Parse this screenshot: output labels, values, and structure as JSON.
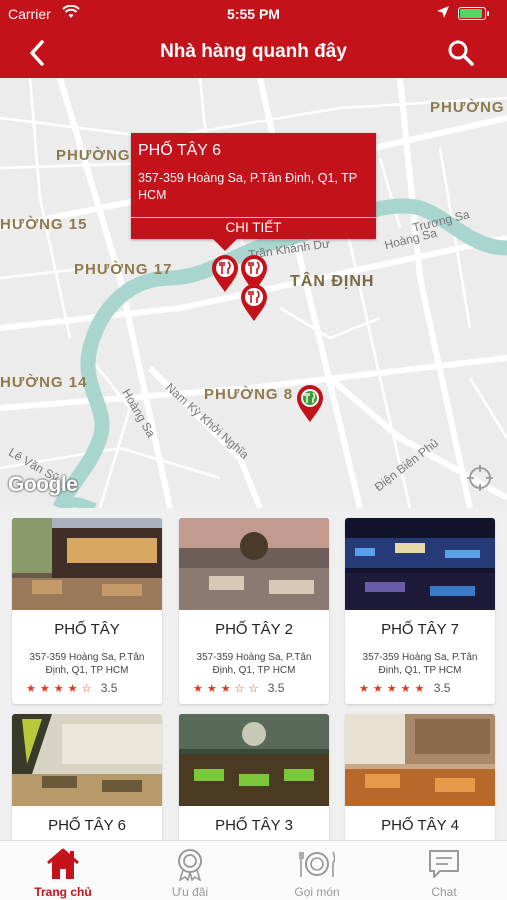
{
  "status_bar": {
    "carrier": "Carrier",
    "time": "5:55 PM",
    "battery_level": 0.9
  },
  "nav": {
    "title": "Nhà hàng quanh đây",
    "back_icon": "chevron-left-icon",
    "search_icon": "search-icon"
  },
  "map": {
    "area_labels": [
      "PHƯỜNG",
      "PHƯỜNG",
      "HƯỜNG 15",
      "PHƯỜNG 17",
      "TÂN ĐỊNH",
      "HƯỜNG 14",
      "PHƯỜNG 8"
    ],
    "street_labels": [
      "Trương Sa",
      "Hoàng Sa",
      "Trần Khánh Dư",
      "Hoàng Sa",
      "Nam Kỳ Khởi Nghĩa",
      "Lê Văn Sỹ",
      "Điện Biên Phủ"
    ],
    "attribution": "Google",
    "callout": {
      "name": "PHỐ TÂY 6",
      "address": "357-359 Hoàng Sa, P.Tân Định, Q1, TP HCM",
      "detail_label": "CHI TIẾT"
    }
  },
  "restaurants": [
    {
      "name": "PHỐ TÂY",
      "address": "357-359 Hoàng Sa, P.Tân Định, Q1, TP HCM",
      "stars": [
        "★",
        "★",
        "★",
        "★",
        "☆"
      ],
      "rating": "3.5"
    },
    {
      "name": "PHỐ TÂY 2",
      "address": "357-359 Hoàng Sa, P.Tân Định, Q1, TP HCM",
      "stars": [
        "★",
        "★",
        "★",
        "☆",
        "☆"
      ],
      "rating": "3.5"
    },
    {
      "name": "PHỐ TÂY 7",
      "address": "357-359 Hoàng Sa, P.Tân Định, Q1, TP HCM",
      "stars": [
        "★",
        "★",
        "★",
        "★",
        "★"
      ],
      "rating": "3.5"
    },
    {
      "name": "PHỐ TÂY 6",
      "address": "",
      "stars": [],
      "rating": ""
    },
    {
      "name": "PHỐ TÂY 3",
      "address": "",
      "stars": [],
      "rating": ""
    },
    {
      "name": "PHỐ TÂY 4",
      "address": "",
      "stars": [],
      "rating": ""
    }
  ],
  "tabs": [
    {
      "label": "Trang chủ",
      "icon": "home-icon",
      "active": true
    },
    {
      "label": "Ưu đãi",
      "icon": "badge-icon",
      "active": false
    },
    {
      "label": "Gọi món",
      "icon": "dish-icon",
      "active": false
    },
    {
      "label": "Chat",
      "icon": "chat-icon",
      "active": false
    }
  ],
  "colors": {
    "brand": "#c4121b",
    "star": "#e03a1e",
    "river": "#a9d5cf"
  }
}
